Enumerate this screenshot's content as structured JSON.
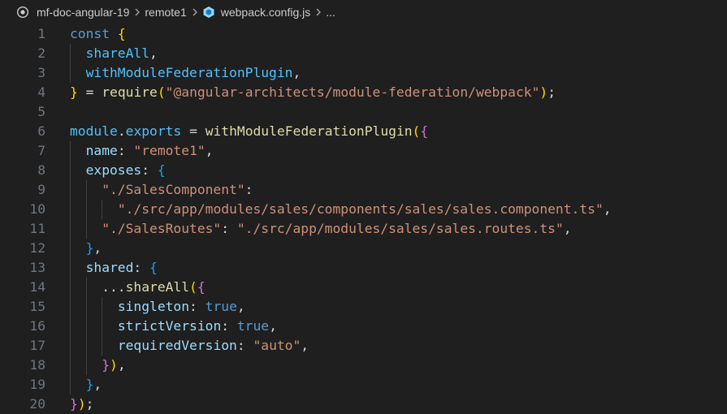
{
  "breadcrumb": {
    "items": [
      {
        "label": "mf-doc-angular-19",
        "icon": "repo-icon"
      },
      {
        "label": "remote1",
        "icon": "folder"
      },
      {
        "label": "webpack.config.js",
        "icon": "webpack-icon"
      },
      {
        "label": "...",
        "icon": "more"
      }
    ],
    "separator_icon": "chevron-right-icon"
  },
  "editor": {
    "line_numbers": [
      "1",
      "2",
      "3",
      "4",
      "5",
      "6",
      "7",
      "8",
      "9",
      "10",
      "11",
      "12",
      "13",
      "14",
      "15",
      "16",
      "17",
      "18",
      "19",
      "20"
    ],
    "colors": {
      "background": "#1f1f1f",
      "keyword": "#569cd6",
      "function": "#dcdcaa",
      "variable": "#9cdcfe",
      "constant": "#4fc1ff",
      "string": "#ce9178",
      "punctuation": "#d4d4d4",
      "bracket_level_1": "#ffd700",
      "bracket_level_2": "#da70d6",
      "bracket_level_3": "#179fff",
      "line_number": "#6e7681"
    },
    "lines": [
      {
        "indent": 0,
        "tokens": [
          {
            "t": "const",
            "k": "kw"
          },
          {
            "t": " ",
            "k": "pn"
          },
          {
            "t": "{",
            "k": "b1"
          }
        ]
      },
      {
        "indent": 1,
        "tokens": [
          {
            "t": "shareAll",
            "k": "cst"
          },
          {
            "t": ",",
            "k": "pn"
          }
        ]
      },
      {
        "indent": 1,
        "tokens": [
          {
            "t": "withModuleFederationPlugin",
            "k": "cst"
          },
          {
            "t": ",",
            "k": "pn"
          }
        ]
      },
      {
        "indent": 0,
        "tokens": [
          {
            "t": "}",
            "k": "b1"
          },
          {
            "t": " = ",
            "k": "pn"
          },
          {
            "t": "require",
            "k": "fn"
          },
          {
            "t": "(",
            "k": "b1"
          },
          {
            "t": "\"@angular-architects/module-federation/webpack\"",
            "k": "str"
          },
          {
            "t": ")",
            "k": "b1"
          },
          {
            "t": ";",
            "k": "pn"
          }
        ]
      },
      {
        "indent": 0,
        "tokens": []
      },
      {
        "indent": 0,
        "tokens": [
          {
            "t": "module",
            "k": "cst"
          },
          {
            "t": ".",
            "k": "pn"
          },
          {
            "t": "exports",
            "k": "cst"
          },
          {
            "t": " = ",
            "k": "pn"
          },
          {
            "t": "withModuleFederationPlugin",
            "k": "fn"
          },
          {
            "t": "(",
            "k": "b1"
          },
          {
            "t": "{",
            "k": "b2"
          }
        ]
      },
      {
        "indent": 1,
        "tokens": [
          {
            "t": "name",
            "k": "var"
          },
          {
            "t": ": ",
            "k": "pn"
          },
          {
            "t": "\"remote1\"",
            "k": "str"
          },
          {
            "t": ",",
            "k": "pn"
          }
        ]
      },
      {
        "indent": 1,
        "tokens": [
          {
            "t": "exposes",
            "k": "var"
          },
          {
            "t": ": ",
            "k": "pn"
          },
          {
            "t": "{",
            "k": "b3"
          }
        ]
      },
      {
        "indent": 2,
        "tokens": [
          {
            "t": "\"./SalesComponent\"",
            "k": "str"
          },
          {
            "t": ":",
            "k": "pn"
          }
        ]
      },
      {
        "indent": 3,
        "tokens": [
          {
            "t": "\"./src/app/modules/sales/components/sales/sales.component.ts\"",
            "k": "str"
          },
          {
            "t": ",",
            "k": "pn"
          }
        ]
      },
      {
        "indent": 2,
        "tokens": [
          {
            "t": "\"./SalesRoutes\"",
            "k": "str"
          },
          {
            "t": ": ",
            "k": "pn"
          },
          {
            "t": "\"./src/app/modules/sales/sales.routes.ts\"",
            "k": "str"
          },
          {
            "t": ",",
            "k": "pn"
          }
        ]
      },
      {
        "indent": 1,
        "tokens": [
          {
            "t": "}",
            "k": "b3"
          },
          {
            "t": ",",
            "k": "pn"
          }
        ]
      },
      {
        "indent": 1,
        "tokens": [
          {
            "t": "shared",
            "k": "var"
          },
          {
            "t": ": ",
            "k": "pn"
          },
          {
            "t": "{",
            "k": "b3"
          }
        ]
      },
      {
        "indent": 2,
        "tokens": [
          {
            "t": "...",
            "k": "pn"
          },
          {
            "t": "shareAll",
            "k": "fn"
          },
          {
            "t": "(",
            "k": "b1"
          },
          {
            "t": "{",
            "k": "b2"
          }
        ]
      },
      {
        "indent": 3,
        "tokens": [
          {
            "t": "singleton",
            "k": "var"
          },
          {
            "t": ": ",
            "k": "pn"
          },
          {
            "t": "true",
            "k": "kw"
          },
          {
            "t": ",",
            "k": "pn"
          }
        ]
      },
      {
        "indent": 3,
        "tokens": [
          {
            "t": "strictVersion",
            "k": "var"
          },
          {
            "t": ": ",
            "k": "pn"
          },
          {
            "t": "true",
            "k": "kw"
          },
          {
            "t": ",",
            "k": "pn"
          }
        ]
      },
      {
        "indent": 3,
        "tokens": [
          {
            "t": "requiredVersion",
            "k": "var"
          },
          {
            "t": ": ",
            "k": "pn"
          },
          {
            "t": "\"auto\"",
            "k": "str"
          },
          {
            "t": ",",
            "k": "pn"
          }
        ]
      },
      {
        "indent": 2,
        "tokens": [
          {
            "t": "}",
            "k": "b2"
          },
          {
            "t": ")",
            "k": "b1"
          },
          {
            "t": ",",
            "k": "pn"
          }
        ]
      },
      {
        "indent": 1,
        "tokens": [
          {
            "t": "}",
            "k": "b3"
          },
          {
            "t": ",",
            "k": "pn"
          }
        ]
      },
      {
        "indent": 0,
        "tokens": [
          {
            "t": "}",
            "k": "b2"
          },
          {
            "t": ")",
            "k": "b1"
          },
          {
            "t": ";",
            "k": "pn"
          }
        ]
      }
    ]
  }
}
